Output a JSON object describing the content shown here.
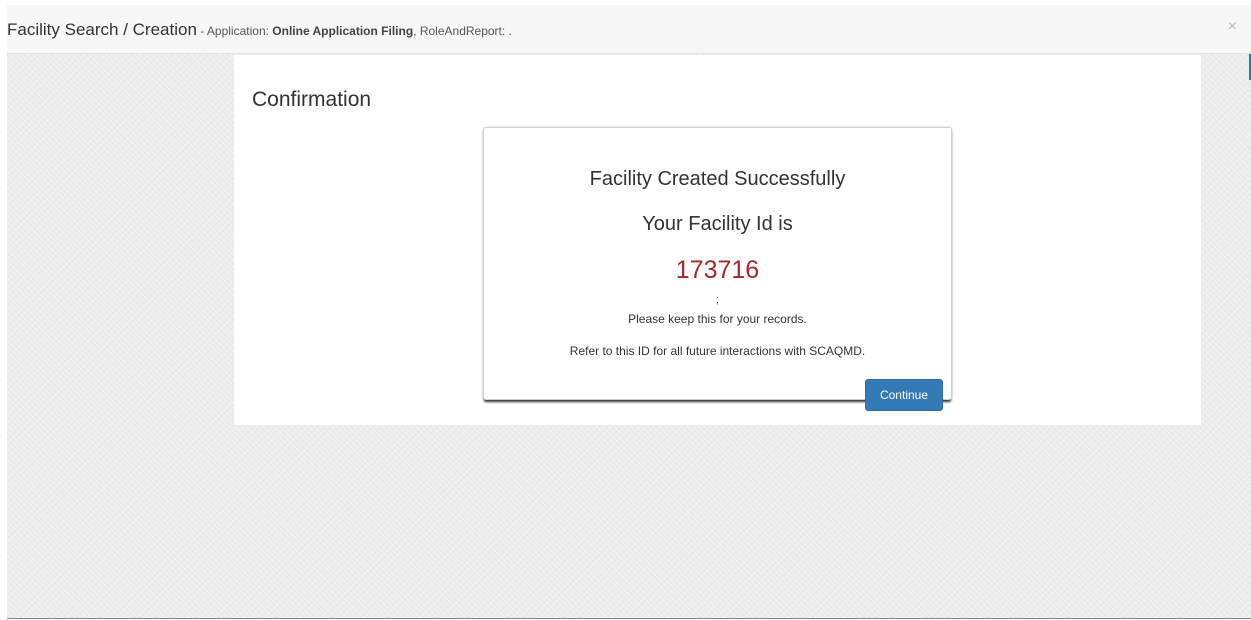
{
  "header": {
    "title": "Facility Search / Creation",
    "meta_prefix": " - Application: ",
    "application_name": "Online Application Filing",
    "meta_suffix": ", RoleAndReport: .",
    "close_symbol": "×"
  },
  "page": {
    "title": "Confirmation"
  },
  "confirmation": {
    "heading": "Facility Created Successfully",
    "subheading": "Your Facility Id is",
    "facility_id": "173716",
    "separator": ";",
    "note_keep": "Please keep this for your records.",
    "note_refer": "Refer to this ID for all future interactions with SCAQMD.",
    "continue_label": "Continue"
  },
  "colors": {
    "facility_id": "#a4282a",
    "button": "#337ab7",
    "accent": "#2e75b6"
  }
}
